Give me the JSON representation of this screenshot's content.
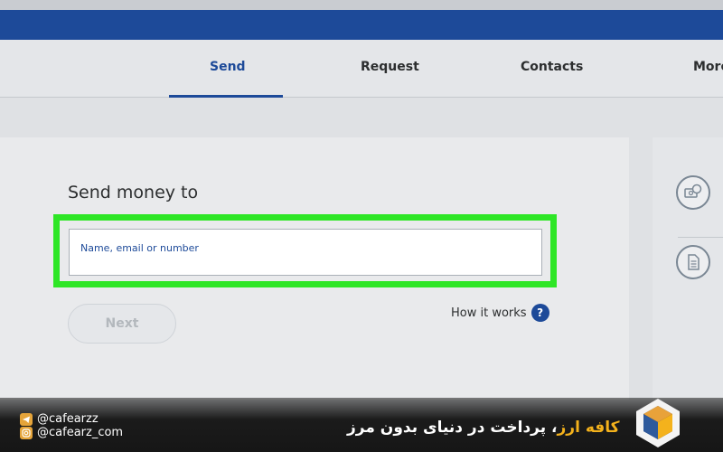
{
  "nav": {
    "tabs": [
      {
        "label": "Send",
        "active": true
      },
      {
        "label": "Request",
        "active": false
      },
      {
        "label": "Contacts",
        "active": false
      },
      {
        "label": "More",
        "active": false
      }
    ]
  },
  "send_form": {
    "title": "Send money to",
    "recipient_placeholder": "Name, email or number",
    "next_label": "Next",
    "how_it_works_label": "How it works",
    "help_glyph": "?"
  },
  "side_panel": {
    "icons": [
      "money-transfer-icon",
      "document-icon"
    ]
  },
  "banner": {
    "telegram_handle": "@cafearzz",
    "instagram_handle": "@cafearz_com",
    "brand": "کافه ارز",
    "slogan_rest": "، پرداخت در دنیای بدون مرز",
    "logo": "cafearz-logo"
  },
  "colors": {
    "primary_blue": "#1d4a99",
    "highlight_green": "#2ee626",
    "brand_orange": "#f4b21c"
  }
}
